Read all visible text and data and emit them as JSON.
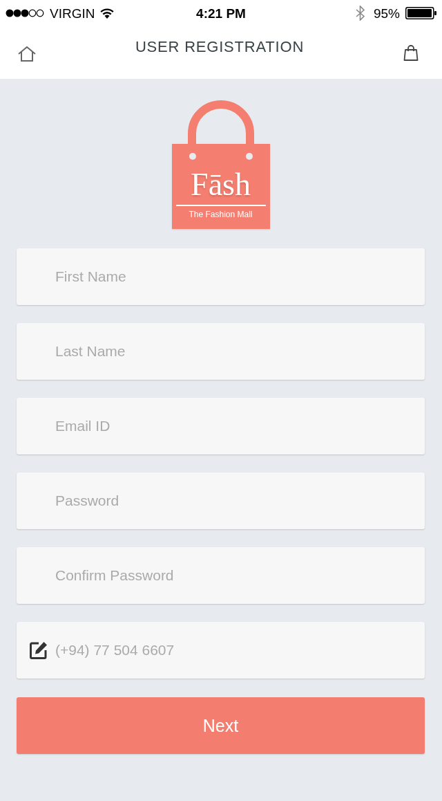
{
  "status_bar": {
    "carrier": "VIRGIN",
    "time": "4:21 PM",
    "battery": "95%"
  },
  "nav": {
    "title": "USER REGISTRATION"
  },
  "logo": {
    "name": "Fāsh",
    "tagline": "The Fashion Mall"
  },
  "fields": [
    {
      "kind": "text",
      "placeholder": "First Name"
    },
    {
      "kind": "text",
      "placeholder": "Last Name"
    },
    {
      "kind": "text",
      "placeholder": "Email ID"
    },
    {
      "kind": "password",
      "placeholder": "Password"
    },
    {
      "kind": "password",
      "placeholder": "Confirm Password"
    },
    {
      "kind": "phone",
      "placeholder": "(+94) 77 504 6607"
    }
  ],
  "next_button": {
    "label": "Next"
  }
}
